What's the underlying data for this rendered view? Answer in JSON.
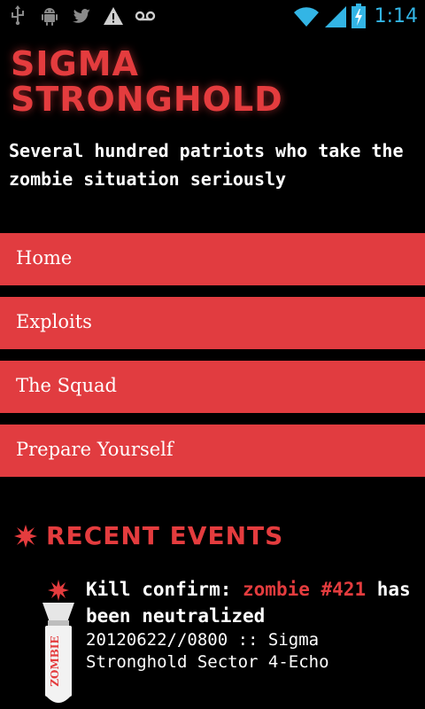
{
  "status_bar": {
    "time": "1:14",
    "left_icons": [
      "usb-icon",
      "android-icon",
      "twitter-icon",
      "warning-icon",
      "voicemail-icon"
    ],
    "right_icons": [
      "wifi-icon",
      "signal-icon",
      "battery-icon"
    ],
    "accent": "#33b5e5"
  },
  "header": {
    "title_line1": "Sigma",
    "title_line2": "Stronghold",
    "tagline": "Several hundred patriots who take the zombie situation seriously"
  },
  "nav": {
    "items": [
      {
        "label": "Home"
      },
      {
        "label": "Exploits"
      },
      {
        "label": "The Squad"
      },
      {
        "label": "Prepare Yourself"
      }
    ]
  },
  "recent_events": {
    "heading": "Recent Events",
    "items": [
      {
        "title_prefix": "Kill confirm: ",
        "title_highlight": "zombie #421",
        "title_suffix": " has been neutralized",
        "meta": "20120622//0800 :: Sigma Stronghold Sector 4-Echo",
        "bomb_label": "ZOMBIE"
      }
    ]
  },
  "colors": {
    "brand_red": "#e43c3e",
    "nav_red": "#e13c40",
    "background": "#000000"
  }
}
